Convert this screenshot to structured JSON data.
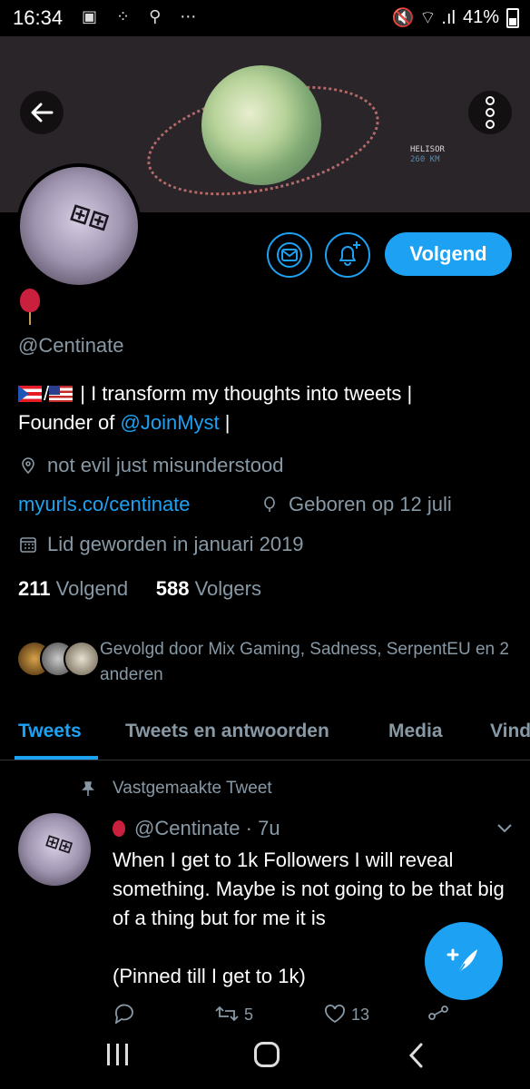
{
  "status_bar": {
    "time": "16:34",
    "battery": "41%",
    "left_icons": "▣ ⁘ ⚲ ⋯",
    "right_icons": "🔇 ⌔ .ıl"
  },
  "banner": {
    "location_name": "HELISOR",
    "distance": "260 KM"
  },
  "profile": {
    "handle": "@Centinate",
    "bio_separator": "/",
    "bio_text": " | I transform my thoughts into tweets |",
    "bio_founder_prefix": "Founder of ",
    "bio_founder_link": "@JoinMyst",
    "bio_founder_suffix": " |",
    "location": "not evil just misunderstood",
    "website": "myurls.co/centinate",
    "birthday": "Geboren op 12 juli",
    "joined": "Lid geworden in januari 2019",
    "following_count": "211",
    "following_label": "Volgend",
    "followers_count": "588",
    "followers_label": "Volgers",
    "followed_by": "Gevolgd door Mix Gaming, Sadness, SerpentEU en 2 anderen"
  },
  "actions": {
    "follow_label": "Volgend"
  },
  "tabs": [
    {
      "label": "Tweets"
    },
    {
      "label": "Tweets en antwoorden"
    },
    {
      "label": "Media"
    },
    {
      "label": "Vind"
    }
  ],
  "pinned_tweet": {
    "pinned_label": "Vastgemaakte Tweet",
    "handle": "@Centinate",
    "time": "· 7u",
    "text_line1": "When I get to 1k Followers I will reveal something. Maybe is not going to be that big of a thing but for me it is",
    "text_line2": "(Pinned till I get to 1k)",
    "retweets": "5",
    "likes": "13"
  },
  "colors": {
    "accent": "#1da1f2",
    "muted": "#8899a6",
    "background": "#000000",
    "balloon": "#c9203e"
  }
}
